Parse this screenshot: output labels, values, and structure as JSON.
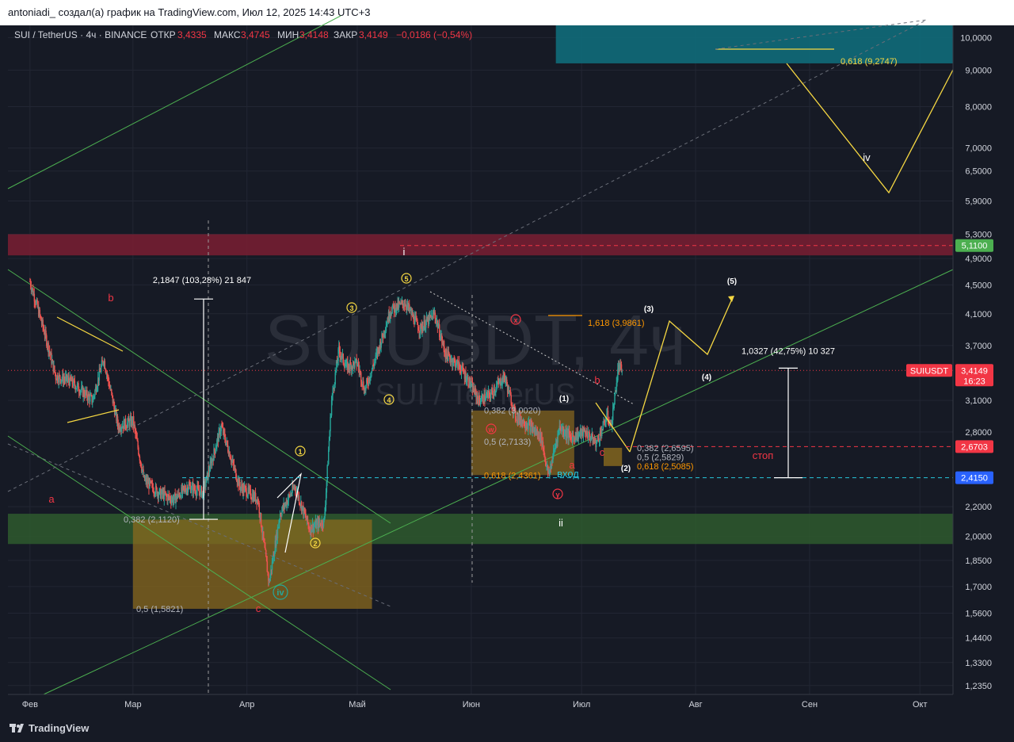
{
  "header": {
    "author_line": "antoniadi_ создал(а) график на TradingView.com, Июл 12, 2025 14:43 UTC+3"
  },
  "legend": {
    "symbol": "SUI / TetherUS · 4ч · BINANCE",
    "open_label": "ОТКР",
    "open_value": "3,4335",
    "high_label": "МАКС",
    "high_value": "3,4745",
    "low_label": "МИН",
    "low_value": "3,4148",
    "close_label": "ЗАКР",
    "close_value": "3,4149",
    "change": "−0,0186 (−0,54%)"
  },
  "watermark": {
    "line1": "SUIUSDT, 4ч",
    "line2": "SUI / TetherUS"
  },
  "colors": {
    "background": "#161a25",
    "grid": "#222633",
    "up": "#26a69a",
    "down": "#ef5350",
    "axis_text": "#d1d4dc",
    "price_tag": "#f23645",
    "entry_tag": "#2962ff",
    "resistance_zone": "#7a1f33",
    "support_zone": "#2e5a2e",
    "fib_box": "#8a6a1e",
    "target_zone": "#0f6b7a",
    "wave_yellow": "#f5d742",
    "channel_green": "#4caf50"
  },
  "chart_data": {
    "type": "candlestick",
    "symbol": "SUI / TetherUS",
    "timeframe": "4ч",
    "exchange": "BINANCE",
    "y_scale": "log",
    "ylim": [
      1.2,
      10.4
    ],
    "y_ticks": [
      "10,0000",
      "9,0000",
      "8,0000",
      "7,0000",
      "6,5000",
      "5,9000",
      "5,3000",
      "4,9000",
      "4,5000",
      "4,1000",
      "3,7000",
      "3,1000",
      "2,8000",
      "2,2000",
      "2,0000",
      "1,8500",
      "1,7000",
      "1,5600",
      "1,4400",
      "1,3300",
      "1,2350"
    ],
    "x_ticks": [
      "Фев",
      "Мар",
      "Апр",
      "Май",
      "Июн",
      "Июл",
      "Авг",
      "Сен",
      "Окт"
    ],
    "price_path": [
      [
        "2025-02-01",
        4.55
      ],
      [
        "2025-02-05",
        3.85
      ],
      [
        "2025-02-08",
        3.35
      ],
      [
        "2025-02-12",
        3.3
      ],
      [
        "2025-02-18",
        3.1
      ],
      [
        "2025-02-21",
        3.55
      ],
      [
        "2025-02-25",
        2.85
      ],
      [
        "2025-03-01",
        2.9
      ],
      [
        "2025-03-04",
        2.4
      ],
      [
        "2025-03-08",
        2.3
      ],
      [
        "2025-03-12",
        2.25
      ],
      [
        "2025-03-16",
        2.35
      ],
      [
        "2025-03-20",
        2.3
      ],
      [
        "2025-03-25",
        2.85
      ],
      [
        "2025-03-30",
        2.35
      ],
      [
        "2025-04-04",
        2.25
      ],
      [
        "2025-04-07",
        1.72
      ],
      [
        "2025-04-10",
        2.15
      ],
      [
        "2025-04-14",
        2.35
      ],
      [
        "2025-04-18",
        2.05
      ],
      [
        "2025-04-22",
        2.1
      ],
      [
        "2025-04-24",
        3.1
      ],
      [
        "2025-04-26",
        3.65
      ],
      [
        "2025-04-28",
        3.45
      ],
      [
        "2025-05-01",
        3.5
      ],
      [
        "2025-05-03",
        3.2
      ],
      [
        "2025-05-06",
        3.55
      ],
      [
        "2025-05-10",
        4.15
      ],
      [
        "2025-05-14",
        4.25
      ],
      [
        "2025-05-18",
        3.9
      ],
      [
        "2025-05-22",
        4.1
      ],
      [
        "2025-05-25",
        3.6
      ],
      [
        "2025-05-29",
        3.45
      ],
      [
        "2025-06-01",
        3.25
      ],
      [
        "2025-06-03",
        3.1
      ],
      [
        "2025-06-06",
        3.15
      ],
      [
        "2025-06-10",
        3.35
      ],
      [
        "2025-06-13",
        2.95
      ],
      [
        "2025-06-17",
        2.85
      ],
      [
        "2025-06-20",
        2.75
      ],
      [
        "2025-06-22",
        2.43
      ],
      [
        "2025-06-25",
        2.85
      ],
      [
        "2025-06-28",
        2.75
      ],
      [
        "2025-07-02",
        2.8
      ],
      [
        "2025-07-05",
        2.7
      ],
      [
        "2025-07-08",
        2.95
      ],
      [
        "2025-07-09",
        2.85
      ],
      [
        "2025-07-11",
        3.45
      ],
      [
        "2025-07-12",
        3.4149
      ]
    ],
    "horizontal_levels": [
      {
        "price": 5.11,
        "label": "5,1100",
        "style": "dashed"
      },
      {
        "price": 3.4149,
        "label": "3,4149",
        "style": "dotted"
      },
      {
        "price": 2.6703,
        "label": "2,6703",
        "style": "dashed"
      },
      {
        "price": 2.415,
        "label": "2,4150",
        "style": "dashed"
      }
    ],
    "price_tags": {
      "symbol": "SUIUSDT",
      "last": "3,4149",
      "countdown": "16:23",
      "stop": "2,6703",
      "entry": "2,4150",
      "resistance": "5,1100"
    },
    "zones": [
      {
        "name": "resistance",
        "from": 4.95,
        "to": 5.3
      },
      {
        "name": "support",
        "from": 1.95,
        "to": 2.15
      },
      {
        "name": "target",
        "from": 9.2,
        "to": 10.4
      }
    ],
    "fib_labels": [
      {
        "text": "0,382 (2,1120)",
        "price": 2.112
      },
      {
        "text": "0,5 (1,5821)",
        "price": 1.5821
      },
      {
        "text": "0,382 (3,0020)",
        "price": 3.002
      },
      {
        "text": "0,5 (2,7133)",
        "price": 2.7133
      },
      {
        "text": "0,618 (2,4361)",
        "price": 2.4361
      },
      {
        "text": "0,382 (2,6595)",
        "price": 2.6595
      },
      {
        "text": "0,5 (2,5829)",
        "price": 2.5829
      },
      {
        "text": "0,618 (2,5085)",
        "price": 2.5085
      },
      {
        "text": "1,618 (3,9861)",
        "price": 3.9861
      },
      {
        "text": "0,618 (9,2747)",
        "price": 9.2747
      }
    ],
    "measurements": [
      {
        "text": "2,1847 (103,28%) 21 847",
        "from": 2.112,
        "to": 4.3
      },
      {
        "text": "1,0327 (42,75%) 10 327",
        "from": 2.415,
        "to": 3.44
      }
    ],
    "wave_labels": [
      "a",
      "b",
      "c",
      "iv",
      "i",
      "ii",
      "iv",
      "1",
      "2",
      "3",
      "4",
      "5",
      "x",
      "w",
      "y",
      "a",
      "b",
      "c",
      "(1)",
      "(2)",
      "(3)",
      "(4)",
      "(5)"
    ],
    "annotations": {
      "entry": "вход",
      "stop": "стоп"
    }
  },
  "footer": {
    "brand": "TradingView"
  }
}
